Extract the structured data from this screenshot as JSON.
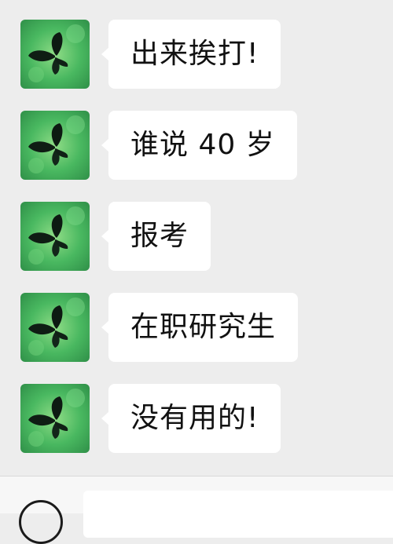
{
  "chat": {
    "messages": [
      {
        "text": "出来挨打!"
      },
      {
        "text": "谁说 40 岁"
      },
      {
        "text": "报考"
      },
      {
        "text": "在职研究生"
      },
      {
        "text": "没有用的!"
      }
    ],
    "avatar_icon": "butterfly-avatar-icon"
  },
  "input_bar": {
    "voice_icon": "voice-icon"
  },
  "colors": {
    "background": "#ededed",
    "bubble": "#ffffff",
    "text": "#111111",
    "avatar_green": "#3fae5c"
  }
}
